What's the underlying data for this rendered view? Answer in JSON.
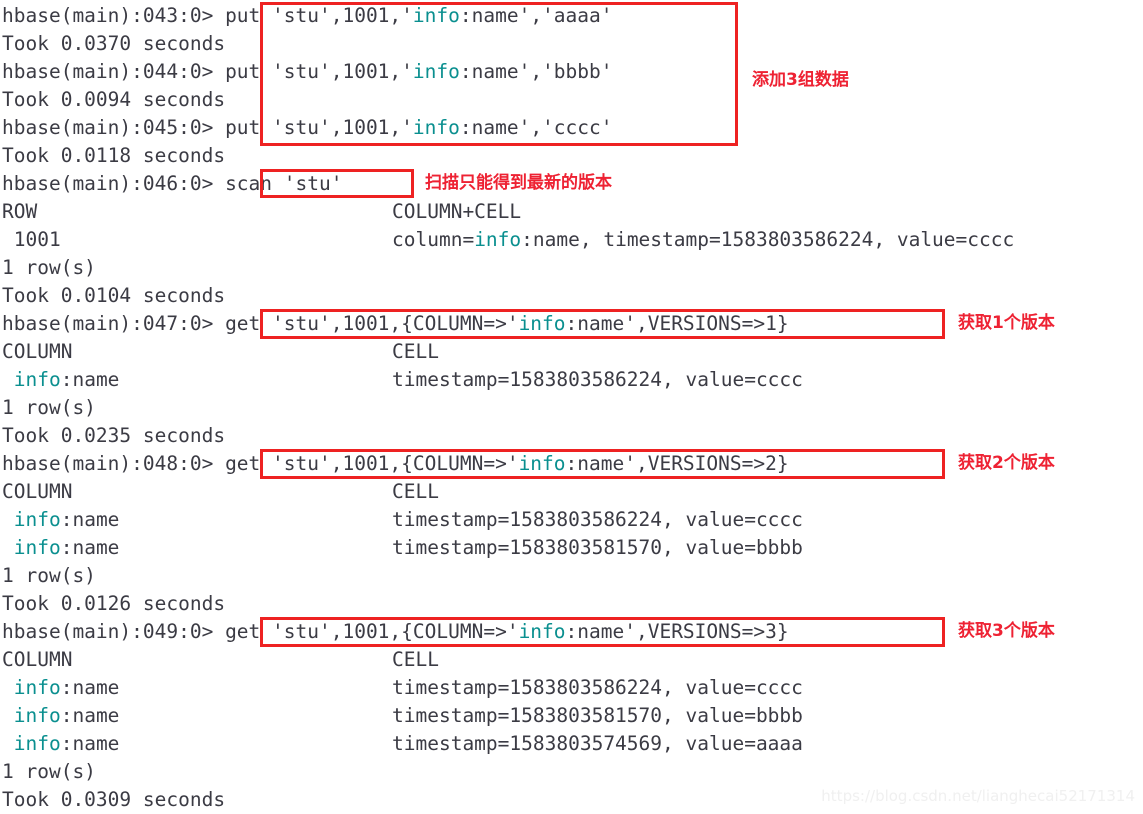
{
  "terminal": {
    "shell": "hbase shell",
    "font_color": "#3b3b44",
    "keyword_color": "#0a8f8f",
    "annotation_color": "#ee2233",
    "box_color": "#ee2222",
    "lines": [
      {
        "prompt": "hbase(main):043:0> ",
        "cmd_pre": "put 'stu',1001,'",
        "cmd_kw": "info",
        "cmd_post": ":name','aaaa'"
      },
      {
        "text": "Took 0.0370 seconds"
      },
      {
        "prompt": "hbase(main):044:0> ",
        "cmd_pre": "put 'stu',1001,'",
        "cmd_kw": "info",
        "cmd_post": ":name','bbbb'"
      },
      {
        "text": "Took 0.0094 seconds"
      },
      {
        "prompt": "hbase(main):045:0> ",
        "cmd_pre": "put 'stu',1001,'",
        "cmd_kw": "info",
        "cmd_post": ":name','cccc'"
      },
      {
        "text": "Took 0.0118 seconds"
      },
      {
        "prompt": "hbase(main):046:0> ",
        "cmd_pre": "scan 'stu'",
        "cmd_kw": "",
        "cmd_post": ""
      },
      {
        "text": "ROW",
        "col2": "COLUMN+CELL"
      },
      {
        "text": " 1001",
        "col2_pre": "column=",
        "col2_kw": "info",
        "col2_post": ":name, timestamp=1583803586224, value=cccc"
      },
      {
        "text": "1 row(s)"
      },
      {
        "text": "Took 0.0104 seconds"
      },
      {
        "prompt": "hbase(main):047:0> ",
        "cmd_pre": "get 'stu',1001,{COLUMN=>'",
        "cmd_kw": "info",
        "cmd_post": ":name',VERSIONS=>1}"
      },
      {
        "text": "COLUMN",
        "col2": "CELL"
      },
      {
        "text": " ",
        "text_kw": "info",
        "text_post": ":name",
        "col2": "timestamp=1583803586224, value=cccc"
      },
      {
        "text": "1 row(s)"
      },
      {
        "text": "Took 0.0235 seconds"
      },
      {
        "prompt": "hbase(main):048:0> ",
        "cmd_pre": "get 'stu',1001,{COLUMN=>'",
        "cmd_kw": "info",
        "cmd_post": ":name',VERSIONS=>2}"
      },
      {
        "text": "COLUMN",
        "col2": "CELL"
      },
      {
        "text": " ",
        "text_kw": "info",
        "text_post": ":name",
        "col2": "timestamp=1583803586224, value=cccc"
      },
      {
        "text": " ",
        "text_kw": "info",
        "text_post": ":name",
        "col2": "timestamp=1583803581570, value=bbbb"
      },
      {
        "text": "1 row(s)"
      },
      {
        "text": "Took 0.0126 seconds"
      },
      {
        "prompt": "hbase(main):049:0> ",
        "cmd_pre": "get 'stu',1001,{COLUMN=>'",
        "cmd_kw": "info",
        "cmd_post": ":name',VERSIONS=>3}"
      },
      {
        "text": "COLUMN",
        "col2": "CELL"
      },
      {
        "text": " ",
        "text_kw": "info",
        "text_post": ":name",
        "col2": "timestamp=1583803586224, value=cccc"
      },
      {
        "text": " ",
        "text_kw": "info",
        "text_post": ":name",
        "col2": "timestamp=1583803581570, value=bbbb"
      },
      {
        "text": " ",
        "text_kw": "info",
        "text_post": ":name",
        "col2": "timestamp=1583803574569, value=aaaa"
      },
      {
        "text": "1 row(s)"
      },
      {
        "text": "Took 0.0309 seconds"
      }
    ]
  },
  "annotations": {
    "add_three_rows": "添加3组数据",
    "scan_latest_only": "扫描只能得到最新的版本",
    "get_one_version": "获取1个版本",
    "get_two_versions": "获取2个版本",
    "get_three_versions": "获取3个版本"
  },
  "watermark": {
    "text": "https://blog.csdn.net/lianghecai52171314"
  }
}
